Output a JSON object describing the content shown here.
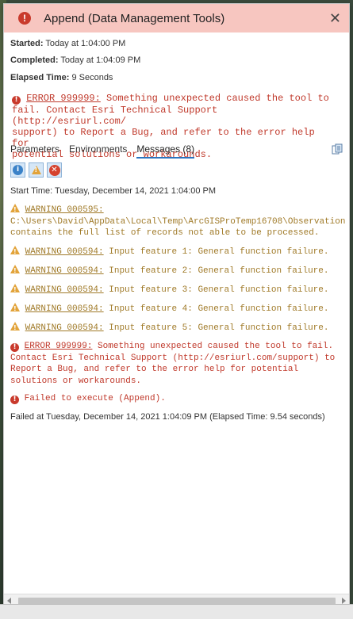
{
  "header": {
    "title": "Append (Data Management Tools)",
    "close_glyph": "✕",
    "bg_color": "#f7c6c0"
  },
  "info": {
    "started_label": "Started:",
    "started_value": "Today at 1:04:00 PM",
    "completed_label": "Completed:",
    "completed_value": "Today at 1:04:09 PM",
    "elapsed_label": "Elapsed Time:",
    "elapsed_value": "9 Seconds"
  },
  "summary_error": {
    "code": "ERROR 999999:",
    "lines": [
      "Something unexpected caused the tool to",
      "fail. Contact Esri Technical Support (http://esriurl.com/",
      "support) to Report a Bug, and refer to the error help for",
      "potential solutions or workarounds."
    ]
  },
  "tabs": [
    {
      "label": "Parameters"
    },
    {
      "label": "Environments"
    },
    {
      "label": "Messages (8)"
    }
  ],
  "messages": {
    "start": "Start Time: Tuesday, December 14, 2021 1:04:00 PM",
    "warning_595": {
      "code": "WARNING 000595:",
      "path": "C:\\Users\\David\\AppData\\Local\\Temp\\ArcGISProTemp16708\\Observation",
      "line2": "contains the full list of records not able to be processed."
    },
    "warnings": [
      {
        "code": "WARNING 000594:",
        "text": " Input feature 1: General function failure."
      },
      {
        "code": "WARNING 000594:",
        "text": " Input feature 2: General function failure."
      },
      {
        "code": "WARNING 000594:",
        "text": " Input feature 3: General function failure."
      },
      {
        "code": "WARNING 000594:",
        "text": " Input feature 4: General function failure."
      },
      {
        "code": "WARNING 000594:",
        "text": " Input feature 5: General function failure."
      }
    ],
    "error_999999": {
      "code": "ERROR 999999:",
      "lines": [
        " Something unexpected caused the tool to fail.",
        "Contact Esri Technical Support (http://esriurl.com/support) to",
        "Report a Bug, and refer to the error help for potential",
        "solutions or workarounds."
      ]
    },
    "failed_execute": "Failed to execute (Append).",
    "failed_at": "Failed at Tuesday, December 14, 2021 1:04:09 PM (Elapsed Time: 9.54 seconds)"
  },
  "colors": {
    "error": "#c0392b",
    "warning": "#a07a28",
    "tab_active": "#2a74c0"
  }
}
